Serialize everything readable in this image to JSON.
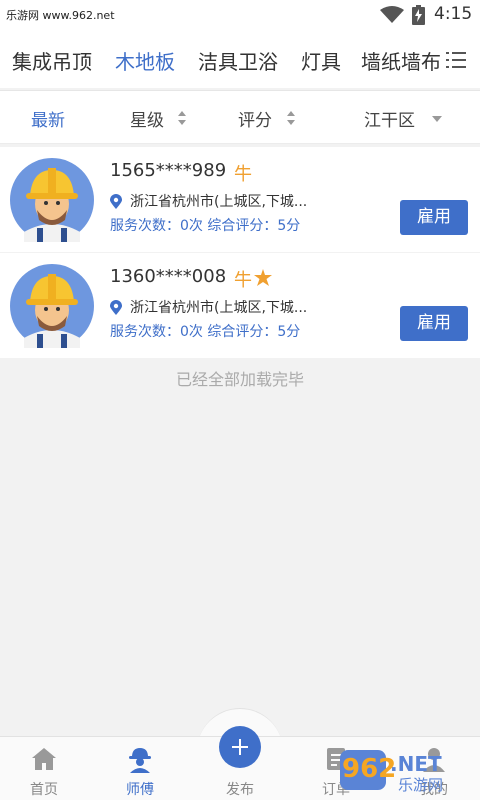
{
  "status_bar": {
    "site": "乐游网 www.962.net",
    "time": "4:15",
    "wifi_icon": "wifi-icon",
    "battery_icon": "battery-charging-icon"
  },
  "categories": {
    "items": [
      "集成吊顶",
      "木地板",
      "洁具卫浴",
      "灯具",
      "墙纸墙布"
    ],
    "active_index": 1,
    "menu_icon": "list-menu-icon"
  },
  "filters": {
    "latest": "最新",
    "level": "星级",
    "rating": "评分",
    "district": "江干区"
  },
  "workers": [
    {
      "phone": "1565****989",
      "level": "牛",
      "star": false,
      "address": "浙江省杭州市(上城区,下城...",
      "stats": "服务次数：0次  综合评分：5分",
      "hire": "雇用"
    },
    {
      "phone": "1360****008",
      "level": "牛",
      "star": true,
      "address": "浙江省杭州市(上城区,下城...",
      "stats": "服务次数：0次  综合评分：5分",
      "hire": "雇用"
    }
  ],
  "list_end": "已经全部加载完毕",
  "bottom_nav": {
    "home": "首页",
    "workers": "师傅",
    "publish": "发布",
    "orders": "订单",
    "mine": "我的",
    "active": "workers"
  },
  "watermark": {
    "num": "962",
    "net": ".NET",
    "sub": "乐游网"
  },
  "colors": {
    "accent": "#3f6fc9",
    "badge": "#f0a030"
  }
}
